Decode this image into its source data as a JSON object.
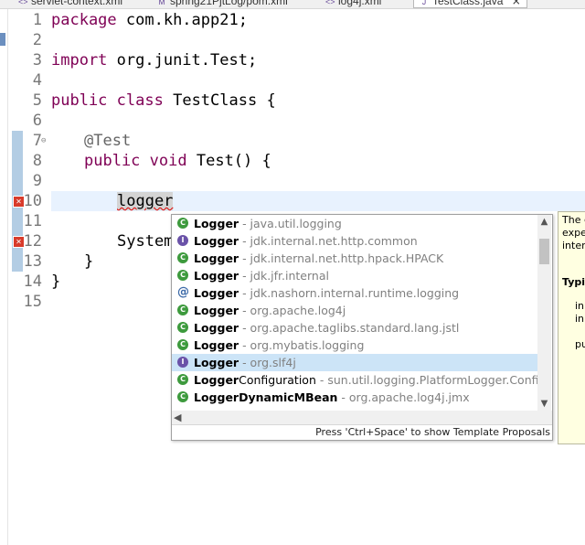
{
  "tabs": [
    {
      "label": "servlet-context.xml",
      "icon": "xml-file-icon"
    },
    {
      "label": "spring21PjtLog/pom.xml",
      "icon": "maven-pom-icon"
    },
    {
      "label": "log4j.xml",
      "icon": "xml-file-icon"
    },
    {
      "label": "TestClass.java",
      "icon": "java-file-icon",
      "active": true
    }
  ],
  "editor": {
    "line_numbers": [
      "1",
      "2",
      "3",
      "4",
      "5",
      "6",
      "7",
      "8",
      "9",
      "10",
      "11",
      "12",
      "13",
      "14",
      "15"
    ],
    "lines": {
      "l1_kw": "package",
      "l1_rest": " com.kh.app21;",
      "l3_kw": "import",
      "l3_rest": " org.junit.Test;",
      "l5_kw1": "public",
      "l5_kw2": "class",
      "l5_rest": " TestClass {",
      "l7": "@Test",
      "l8_kw1": "public",
      "l8_kw2": "void",
      "l8_rest": " Test() {",
      "l10": "logger",
      "l12": "System.",
      "l13": "}",
      "l14": "}"
    }
  },
  "proposals": {
    "items": [
      {
        "icon": "class-icon",
        "name": "Logger",
        "suffix": "",
        "qualifier": " - java.util.logging"
      },
      {
        "icon": "interface-icon",
        "name": "Logger",
        "suffix": "",
        "qualifier": " - jdk.internal.net.http.common"
      },
      {
        "icon": "class-icon",
        "name": "Logger",
        "suffix": "",
        "qualifier": " - jdk.internal.net.http.hpack.HPACK"
      },
      {
        "icon": "class-icon",
        "name": "Logger",
        "suffix": "",
        "qualifier": " - jdk.jfr.internal"
      },
      {
        "icon": "annotation-icon",
        "name": "Logger",
        "suffix": "",
        "qualifier": " - jdk.nashorn.internal.runtime.logging"
      },
      {
        "icon": "class-icon",
        "name": "Logger",
        "suffix": "",
        "qualifier": " - org.apache.log4j"
      },
      {
        "icon": "class-icon",
        "name": "Logger",
        "suffix": "",
        "qualifier": " - org.apache.taglibs.standard.lang.jstl"
      },
      {
        "icon": "class-icon",
        "name": "Logger",
        "suffix": "",
        "qualifier": " - org.mybatis.logging"
      },
      {
        "icon": "interface-icon",
        "name": "Logger",
        "suffix": "",
        "qualifier": " - org.slf4j",
        "selected": true
      },
      {
        "icon": "abstract-class-icon",
        "name": "Logger",
        "suffix": "Configuration",
        "qualifier": " - sun.util.logging.PlatformLogger.ConfigurableB"
      },
      {
        "icon": "class-icon",
        "name": "Logger",
        "suffix": "DynamicMBean",
        "qualifier": " - org.apache.log4j.jmx"
      }
    ],
    "status": "Press 'Ctrl+Space' to show Template Proposals"
  },
  "javadoc": {
    "lines": [
      "The c",
      "expe",
      "inter",
      "",
      "Typic",
      "",
      "in",
      "in",
      "",
      "pu"
    ]
  },
  "colors": {
    "keyword": "#7f0055",
    "annotation": "#646464",
    "selection": "#cce4f7",
    "current_line": "#e8f2fe",
    "doc_bg": "#ffffe1",
    "error": "#d83b2b"
  }
}
